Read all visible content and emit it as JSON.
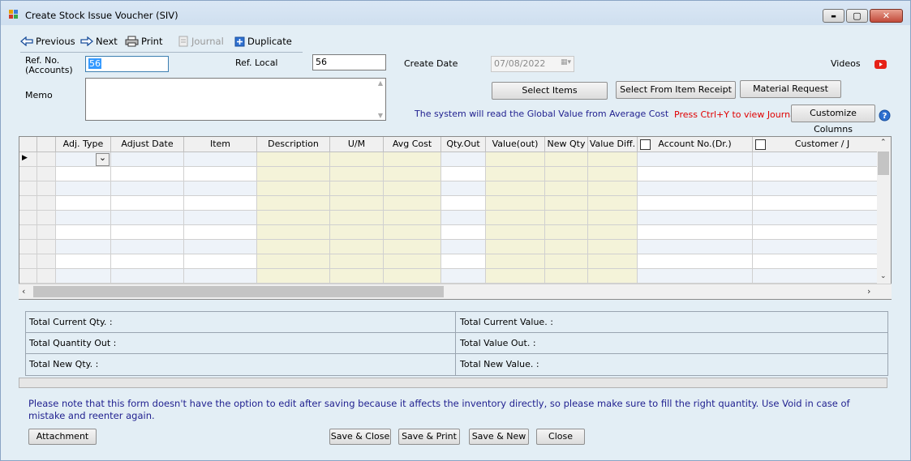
{
  "window": {
    "title": "Create Stock Issue Voucher (SIV)",
    "controls": {
      "minimize": "▬",
      "maximize": "▢",
      "close": "✕"
    }
  },
  "toolbar": {
    "previous": "Previous",
    "next": "Next",
    "print": "Print",
    "journal": "Journal",
    "duplicate": "Duplicate"
  },
  "form": {
    "ref_no_label_line1": "Ref. No.",
    "ref_no_label_line2": "(Accounts)",
    "ref_no_value": "56",
    "ref_local_label": "Ref. Local",
    "ref_local_value": "56",
    "create_date_label": "Create Date",
    "create_date_value": "07/08/2022",
    "videos_label": "Videos",
    "memo_label": "Memo",
    "memo_value": ""
  },
  "actions": {
    "select_items": "Select Items",
    "select_from_receipt": "Select From Item Receipt",
    "material_request": "Material Request",
    "customize_columns": "Customize Columns"
  },
  "messages": {
    "global_value": "The system will read the Global Value from Average Cost",
    "journal_hint": "Press Ctrl+Y to view Journal",
    "inventory_note": "Please note that this form doesn't have the option to edit after saving because it affects the inventory directly, so please make sure to fill the right quantity. Use Void in case of mistake and reenter again."
  },
  "grid": {
    "columns": [
      "Adj. Type",
      "Adjust Date",
      "Item",
      "Description",
      "U/M",
      "Avg Cost",
      "Qty.Out",
      "Value(out)",
      "New Qty",
      "Value Diff.",
      "Account No.(Dr.)",
      "Customer / J"
    ]
  },
  "totals": {
    "total_current_qty": "Total Current Qty. :",
    "total_quantity_out": "Total Quantity Out :",
    "total_new_qty": "Total New Qty. :",
    "total_current_value": "Total Current Value. :",
    "total_value_out": "Total Value Out. :",
    "total_new_value": "Total New Value. :"
  },
  "footer": {
    "attachment": "Attachment",
    "save_close": "Save & Close",
    "save_print": "Save & Print",
    "save_new": "Save & New",
    "close": "Close"
  },
  "colors": {
    "background": "#e3eef5",
    "readonly_column": "#f4f3d9",
    "note_text": "#1f1f8f",
    "journal_hint_text": "#e00000"
  }
}
